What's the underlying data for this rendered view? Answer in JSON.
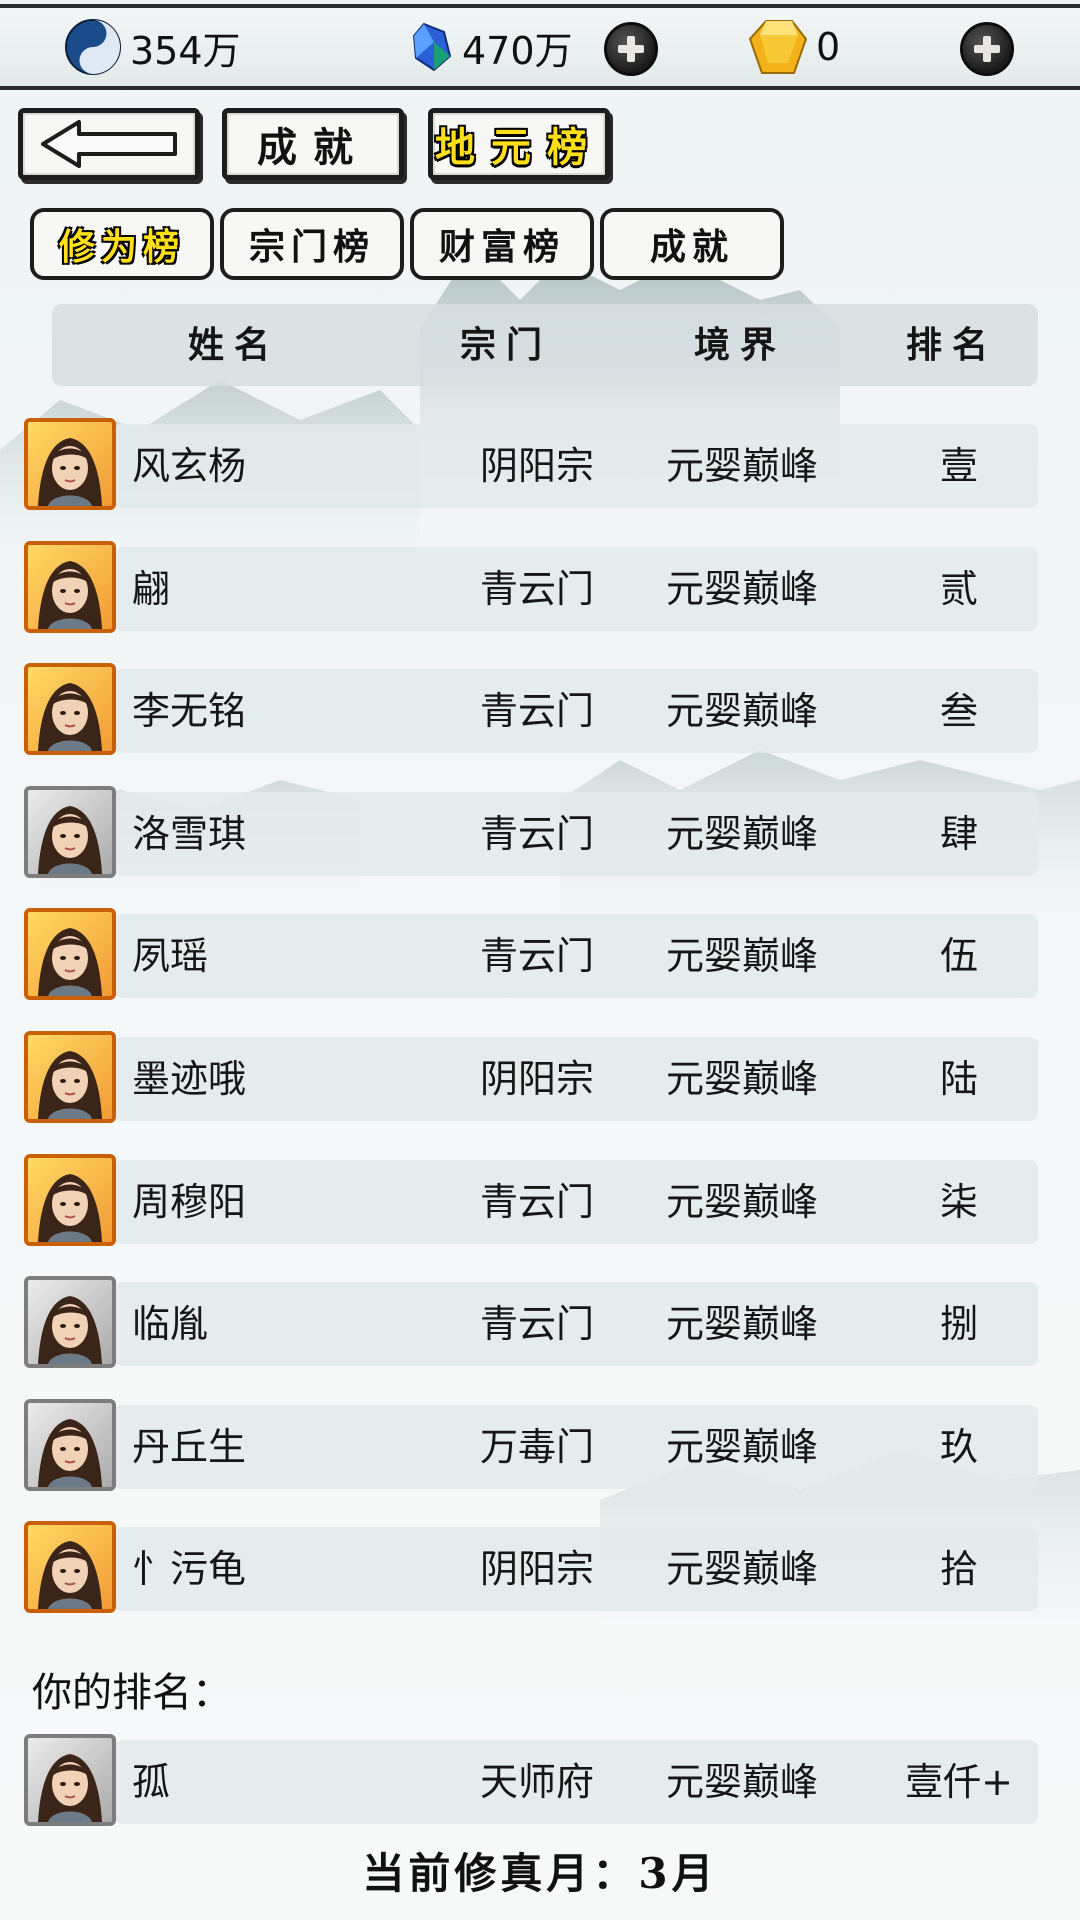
{
  "resources": {
    "spirit": {
      "value": "354万",
      "icon": "yin-yang-icon"
    },
    "crystal": {
      "value": "470万",
      "icon": "blue-crystal-icon"
    },
    "gold": {
      "value": "0",
      "icon": "gold-gem-icon"
    }
  },
  "nav": {
    "back_icon": "left-arrow-icon",
    "achievement_label": "成就",
    "earth_ranking_label": "地元榜"
  },
  "tabs": [
    {
      "label": "修为榜",
      "active": true
    },
    {
      "label": "宗门榜",
      "active": false
    },
    {
      "label": "财富榜",
      "active": false
    },
    {
      "label": "成就",
      "active": false
    }
  ],
  "table": {
    "headers": {
      "name": "姓名",
      "sect": "宗门",
      "realm": "境界",
      "rank": "排名"
    },
    "rows": [
      {
        "name": "风玄杨",
        "sect": "阴阳宗",
        "realm": "元婴巅峰",
        "rank": "壹",
        "frame": "gold"
      },
      {
        "name": "翩",
        "sect": "青云门",
        "realm": "元婴巅峰",
        "rank": "贰",
        "frame": "gold"
      },
      {
        "name": "李无铭",
        "sect": "青云门",
        "realm": "元婴巅峰",
        "rank": "叁",
        "frame": "gold"
      },
      {
        "name": "洛雪琪",
        "sect": "青云门",
        "realm": "元婴巅峰",
        "rank": "肆",
        "frame": "silver"
      },
      {
        "name": "夙瑶",
        "sect": "青云门",
        "realm": "元婴巅峰",
        "rank": "伍",
        "frame": "gold"
      },
      {
        "name": "墨迹哦",
        "sect": "阴阳宗",
        "realm": "元婴巅峰",
        "rank": "陆",
        "frame": "gold"
      },
      {
        "name": "周穆阳",
        "sect": "青云门",
        "realm": "元婴巅峰",
        "rank": "柒",
        "frame": "gold"
      },
      {
        "name": "临胤",
        "sect": "青云门",
        "realm": "元婴巅峰",
        "rank": "捌",
        "frame": "silver"
      },
      {
        "name": "丹丘生",
        "sect": "万毒门",
        "realm": "元婴巅峰",
        "rank": "玖",
        "frame": "silver"
      },
      {
        "name": "忄污龟",
        "sect": "阴阳宗",
        "realm": "元婴巅峰",
        "rank": "拾",
        "frame": "gold"
      }
    ]
  },
  "my_rank": {
    "label": "你的排名：",
    "name": "孤",
    "sect": "天师府",
    "realm": "元婴巅峰",
    "rank": "壹仟+",
    "frame": "silver"
  },
  "footer": {
    "text": "当前修真月：3月"
  }
}
